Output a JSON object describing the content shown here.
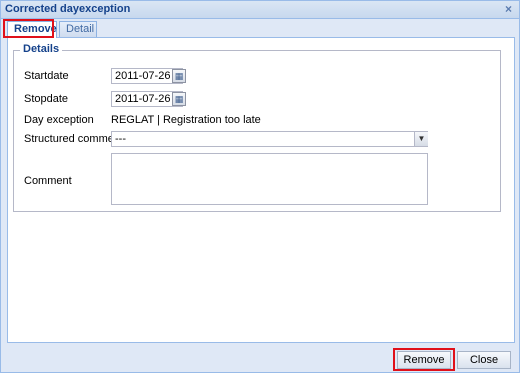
{
  "window": {
    "title": "Corrected dayexception",
    "close_symbol": "×"
  },
  "tabs": [
    {
      "label": "Remove",
      "active": true
    },
    {
      "label": "Detail",
      "active": false
    }
  ],
  "details": {
    "legend": "Details",
    "startdate": {
      "label": "Startdate",
      "value": "2011-07-26"
    },
    "stopdate": {
      "label": "Stopdate",
      "value": "2011-07-26"
    },
    "day_exception": {
      "label": "Day exception",
      "value": "REGLAT | Registration too late"
    },
    "structured_comment": {
      "label": "Structured comment",
      "value": "---"
    },
    "comment": {
      "label": "Comment",
      "value": ""
    }
  },
  "footer": {
    "remove_label": "Remove",
    "close_label": "Close"
  },
  "icons": {
    "calendar": "calendar-icon",
    "dropdown": "chevron-down-icon",
    "close": "close-icon"
  },
  "colors": {
    "title_text": "#15428b",
    "highlight": "#e0101a",
    "window_border": "#99bbe8"
  }
}
